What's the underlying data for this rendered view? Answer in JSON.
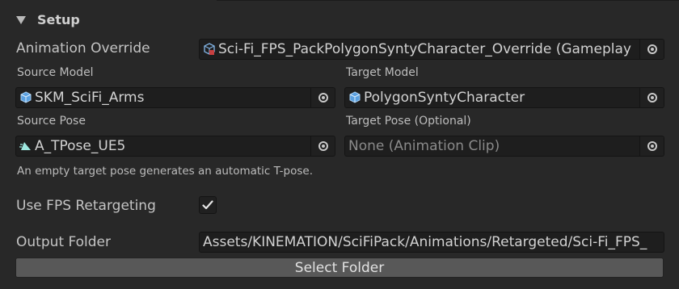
{
  "section": {
    "title": "Setup"
  },
  "fields": {
    "animation_override": {
      "label": "Animation Override",
      "value": "Sci-Fi_FPS_PackPolygonSyntyCharacter_Override (Gameplay",
      "icon": "animator-override-icon"
    },
    "source_model": {
      "label": "Source Model",
      "value": "SKM_SciFi_Arms",
      "icon": "prefab-cube-icon"
    },
    "target_model": {
      "label": "Target Model",
      "value": "PolygonSyntyCharacter",
      "icon": "prefab-cube-icon"
    },
    "source_pose": {
      "label": "Source Pose",
      "value": "A_TPose_UE5",
      "icon": "animation-clip-icon"
    },
    "target_pose": {
      "label": "Target Pose (Optional)",
      "value": "None (Animation Clip)"
    }
  },
  "help_text": "An empty target pose generates an automatic T-pose.",
  "fps_retargeting": {
    "label": "Use FPS Retargeting",
    "checked": true
  },
  "output_folder": {
    "label": "Output Folder",
    "value": "Assets/KINEMATION/SciFiPack/Animations/Retargeted/Sci-Fi_FPS_"
  },
  "select_folder_button": "Select Folder",
  "colors": {
    "background": "#282828",
    "field": "#1e1e1e",
    "button": "#585858",
    "accent_icon": "#5aa0e0"
  }
}
